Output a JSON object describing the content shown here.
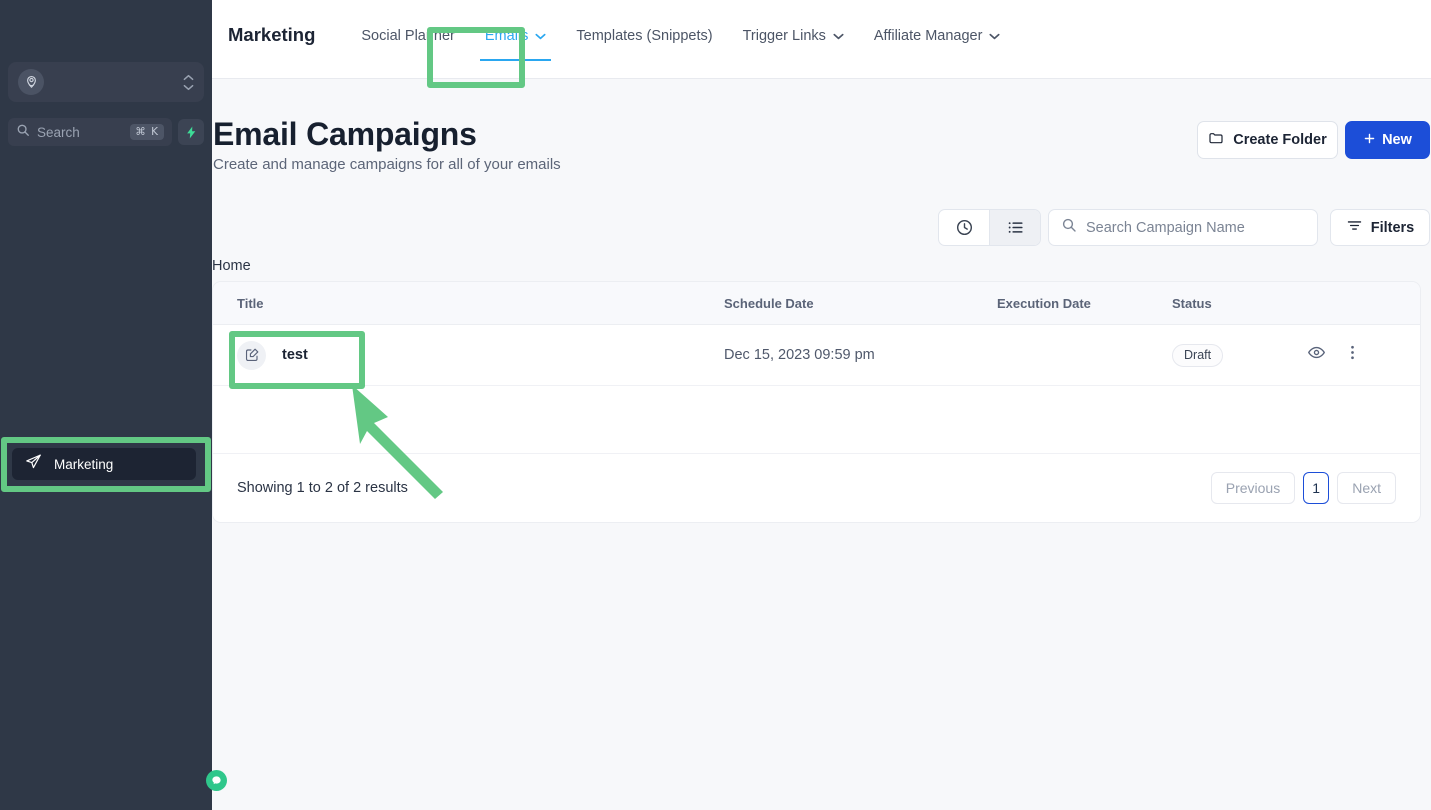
{
  "colors": {
    "sidebar_bg": "#2f3847",
    "highlight_green": "#63c884",
    "accent_blue": "#1c4ed8",
    "tab_active_blue": "#2aa7f0",
    "page_bg": "#f7f8fa"
  },
  "sidebar": {
    "location_switcher": {
      "avatar_icon": "location-pin-person-icon",
      "value": "",
      "stepper_icon": "up-down-chevrons-icon"
    },
    "search": {
      "placeholder": "Search",
      "icon": "search-icon",
      "shortcut": "⌘ K",
      "quick_action_icon": "lightning-bolt-icon"
    },
    "items": [
      {
        "label": "Marketing",
        "icon": "paper-plane-icon",
        "active": true,
        "highlighted": true
      }
    ],
    "chat_bubble_icon": "chat-bubble-icon"
  },
  "topnav": {
    "app_title": "Marketing",
    "tabs": [
      {
        "label": "Social Planner",
        "has_chevron": false,
        "active": false
      },
      {
        "label": "Emails",
        "has_chevron": true,
        "active": true,
        "highlighted": true
      },
      {
        "label": "Templates (Snippets)",
        "has_chevron": false,
        "active": false
      },
      {
        "label": "Trigger Links",
        "has_chevron": true,
        "active": false
      },
      {
        "label": "Affiliate Manager",
        "has_chevron": true,
        "active": false
      }
    ],
    "chevron_icon": "chevron-down-icon"
  },
  "page": {
    "title": "Email Campaigns",
    "subtitle": "Create and manage campaigns for all of your emails",
    "create_folder_label": "Create Folder",
    "create_folder_icon": "folder-icon",
    "new_label": "New",
    "new_icon": "plus-icon"
  },
  "toolbar": {
    "view_toggle": [
      {
        "icon": "clock-history-icon",
        "selected": false
      },
      {
        "icon": "list-view-icon",
        "selected": true
      }
    ],
    "search": {
      "placeholder": "Search Campaign Name",
      "value": "",
      "icon": "search-icon"
    },
    "filters_label": "Filters",
    "filters_icon": "filter-icon"
  },
  "breadcrumb": {
    "items": [
      "Home"
    ]
  },
  "table": {
    "columns": [
      "Title",
      "Schedule Date",
      "Execution Date",
      "Status"
    ],
    "rows": [
      {
        "title": "test",
        "title_icon": "edit-document-icon",
        "schedule_date": "Dec 15, 2023 09:59 pm",
        "execution_date": "",
        "status": "Draft",
        "actions": [
          {
            "icon": "eye-icon",
            "label": ""
          },
          {
            "icon": "more-vertical-icon",
            "label": ""
          }
        ],
        "highlighted": true
      }
    ],
    "footer": {
      "showing": "Showing 1 to 2 of 2 results",
      "pagination": {
        "previous_label": "Previous",
        "pages": [
          "1"
        ],
        "current_page": "1",
        "next_label": "Next"
      }
    }
  },
  "annotations": {
    "arrow": {
      "icon": "pointer-arrow-icon",
      "points_to": "table-row-title-test"
    }
  }
}
